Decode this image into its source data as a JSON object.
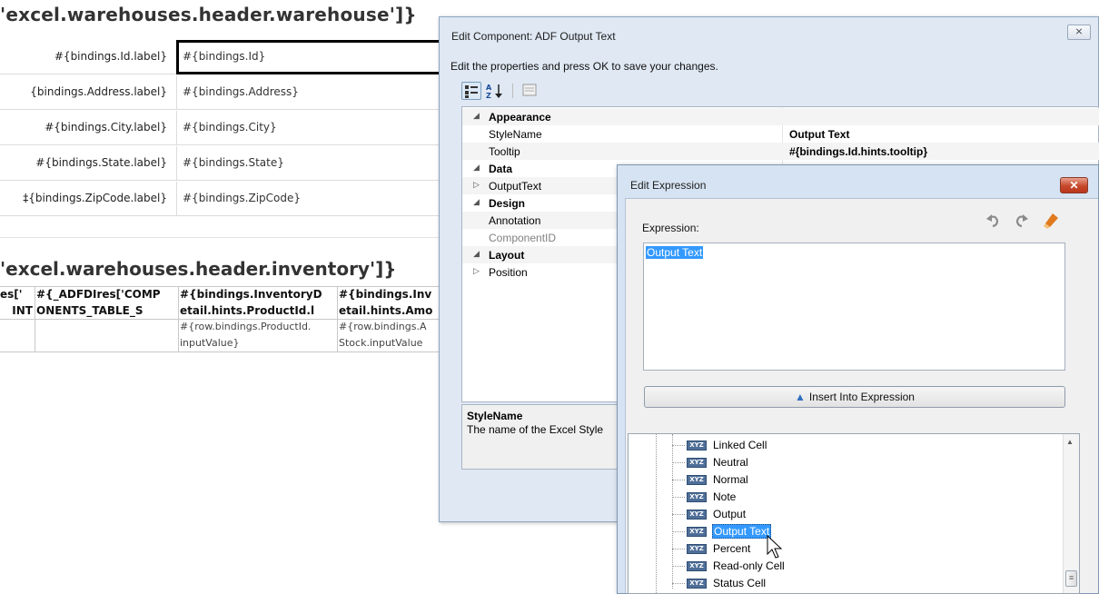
{
  "sheet": {
    "warehouse_header": "'excel.warehouses.header.warehouse']}",
    "inventory_header": "'excel.warehouses.header.inventory']}",
    "form_rows": [
      {
        "label": "#{bindings.Id.label}",
        "value": "#{bindings.Id}"
      },
      {
        "label": "{bindings.Address.label}",
        "value": "#{bindings.Address}"
      },
      {
        "label": "#{bindings.City.label}",
        "value": "#{bindings.City}"
      },
      {
        "label": "#{bindings.State.label}",
        "value": "#{bindings.State}"
      },
      {
        "label": "‡{bindings.ZipCode.label}",
        "value": "#{bindings.ZipCode}"
      }
    ],
    "table": {
      "headers_row1": [
        "es['",
        "#{_ADFDIres['COMP",
        "#{bindings.InventoryD",
        "#{bindings.Inv"
      ],
      "headers_row2": [
        "INT",
        "ONENTS_TABLE_S",
        "etail.hints.ProductId.l",
        "etail.hints.Amo"
      ],
      "body_row1": [
        "",
        "",
        "#{row.bindings.ProductId.",
        "#{row.bindings.A"
      ],
      "body_row2": [
        "",
        "",
        "inputValue}",
        "Stock.inputValue"
      ]
    }
  },
  "edit_component": {
    "title": "Edit Component: ADF Output Text",
    "close": "⨯",
    "instructions": "Edit the properties and press OK to save your changes.",
    "properties": [
      {
        "kind": "cat",
        "name": "Appearance",
        "twisty": "◢"
      },
      {
        "kind": "prop",
        "name": "StyleName",
        "value": "Output Text"
      },
      {
        "kind": "prop",
        "name": "Tooltip",
        "value": "#{bindings.Id.hints.tooltip}"
      },
      {
        "kind": "cat",
        "name": "Data",
        "twisty": "◢"
      },
      {
        "kind": "prop-exp",
        "name": "OutputText",
        "twisty": "▷"
      },
      {
        "kind": "cat",
        "name": "Design",
        "twisty": "◢"
      },
      {
        "kind": "prop",
        "name": "Annotation",
        "value": ""
      },
      {
        "kind": "prop-dim",
        "name": "ComponentID",
        "value": ""
      },
      {
        "kind": "cat",
        "name": "Layout",
        "twisty": "◢"
      },
      {
        "kind": "prop-exp",
        "name": "Position",
        "twisty": "▷"
      }
    ],
    "description_title": "StyleName",
    "description_text": "The name of the Excel Style"
  },
  "edit_expression": {
    "title": "Edit Expression",
    "close": "✕",
    "expression_label": "Expression:",
    "expression_value": "Output Text",
    "insert_button": "Insert Into Expression",
    "icons": [
      "undo-icon",
      "redo-icon",
      "eraser-icon"
    ],
    "tree_items": [
      {
        "name": "Linked Cell",
        "icon": "XYZ"
      },
      {
        "name": "Neutral",
        "icon": "XYZ"
      },
      {
        "name": "Normal",
        "icon": "XYZ"
      },
      {
        "name": "Note",
        "icon": "XYZ"
      },
      {
        "name": "Output",
        "icon": "XYZ"
      },
      {
        "name": "Output Text",
        "icon": "XYZ",
        "selected": true
      },
      {
        "name": "Percent",
        "icon": "XYZ"
      },
      {
        "name": "Read-only Cell",
        "icon": "XYZ"
      },
      {
        "name": "Status Cell",
        "icon": "XYZ"
      }
    ]
  },
  "colors": {
    "selection": "#3399ff",
    "dialog_bg": "#dfe8f3",
    "close_red": "#c7482c"
  }
}
